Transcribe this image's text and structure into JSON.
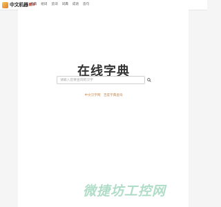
{
  "header": {
    "logo_text": "中文机器",
    "logo_tag": "翻译",
    "nav": [
      "字典",
      "组词",
      "造词",
      "词典",
      "成语",
      "造句"
    ]
  },
  "main": {
    "title": "在线字典",
    "search": {
      "placeholder": "请输入您要查询的汉字"
    },
    "links": [
      "中文汉字网",
      "百度字典查询"
    ]
  },
  "watermark": "微捷坊工控网",
  "colors": {
    "link": "#c68a4e",
    "watermark": "#6fc29a",
    "background": "#f5f5f5"
  }
}
